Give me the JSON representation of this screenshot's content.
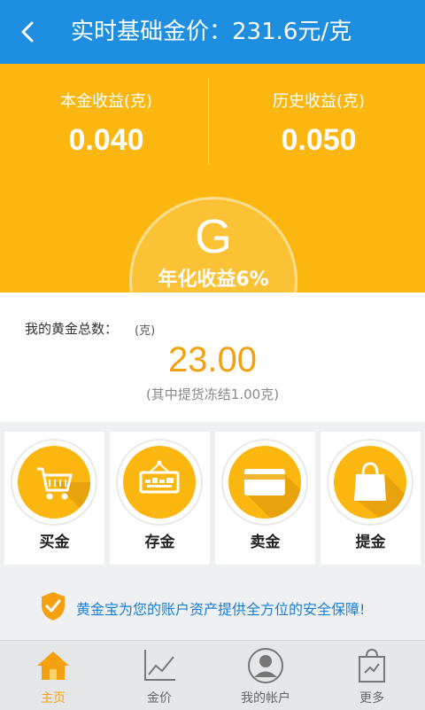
{
  "header": {
    "title": "实时基础金价：231.6元/克"
  },
  "earnings": {
    "principal": {
      "label": "本金收益(克)",
      "value": "0.040"
    },
    "history": {
      "label": "历史收益(克)",
      "value": "0.050"
    }
  },
  "coin": {
    "letter": "G",
    "rate_text": "年化收益6%"
  },
  "total": {
    "label": "我的黄金总数：",
    "unit": "(克)",
    "value": "23.00",
    "note": "(其中提货冻结1.00克)"
  },
  "actions": [
    {
      "label": "买金",
      "icon": "cart-icon"
    },
    {
      "label": "存金",
      "icon": "deposit-sign-icon"
    },
    {
      "label": "卖金",
      "icon": "card-icon"
    },
    {
      "label": "提金",
      "icon": "bag-icon"
    }
  ],
  "security": {
    "text": "黄金宝为您的账户资产提供全方位的安全保障!",
    "icon": "shield-check-icon"
  },
  "tabs": [
    {
      "label": "主页",
      "icon": "home-icon",
      "active": true
    },
    {
      "label": "金价",
      "icon": "chart-icon",
      "active": false
    },
    {
      "label": "我的帐户",
      "icon": "user-icon",
      "active": false
    },
    {
      "label": "更多",
      "icon": "more-bag-icon",
      "active": false
    }
  ],
  "colors": {
    "header": "#1e8fe0",
    "gold": "#fbb70f",
    "accent": "#f5a10f",
    "link": "#1b7fd6"
  }
}
